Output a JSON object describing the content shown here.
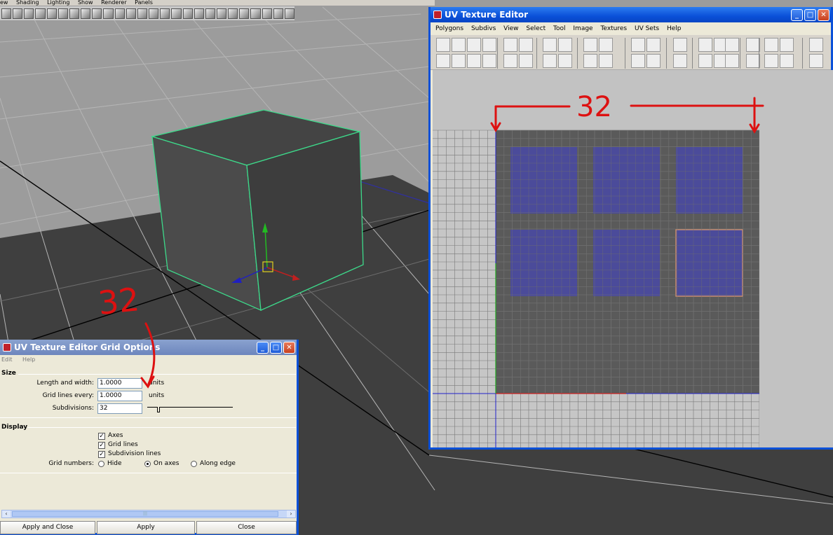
{
  "viewport": {
    "menu": [
      "ew",
      "Shading",
      "Lighting",
      "Show",
      "Renderer",
      "Panels"
    ],
    "shelf_icon_count": 26
  },
  "uv_editor": {
    "title": "UV Texture Editor",
    "menu": [
      "Polygons",
      "Subdivs",
      "View",
      "Select",
      "Tool",
      "Image",
      "Textures",
      "UV Sets",
      "Help"
    ],
    "shell_count": 6,
    "selected_shell": 6
  },
  "grid_options": {
    "title": "UV Texture Editor Grid Options",
    "menu": [
      "Edit",
      "Help"
    ],
    "size": {
      "section_title": "Size",
      "length_label": "Length and width:",
      "length_value": "1.0000",
      "length_unit": "units",
      "grid_every_label": "Grid lines every:",
      "grid_every_value": "1.0000",
      "grid_every_unit": "units",
      "subdivisions_label": "Subdivisions:",
      "subdivisions_value": "32"
    },
    "display": {
      "section_title": "Display",
      "axes_label": "Axes",
      "axes_checked": true,
      "grid_lines_label": "Grid lines",
      "grid_lines_checked": true,
      "subdivision_lines_label": "Subdivision lines",
      "subdivision_lines_checked": true,
      "grid_numbers_label": "Grid numbers:",
      "grid_numbers_options": [
        "Hide",
        "On axes",
        "Along edge"
      ],
      "grid_numbers_selected": "On axes"
    },
    "buttons": {
      "apply_close": "Apply and Close",
      "apply": "Apply",
      "close": "Close"
    }
  },
  "annotations": {
    "top_number": "32",
    "left_number": "32"
  },
  "colors": {
    "window_frame": "#0a50d8",
    "uv_shell": "#4a4aa0",
    "uv_selected_border": "#f0a070",
    "annotation": "#dd1111",
    "cube_wire": "#3dd98a"
  }
}
